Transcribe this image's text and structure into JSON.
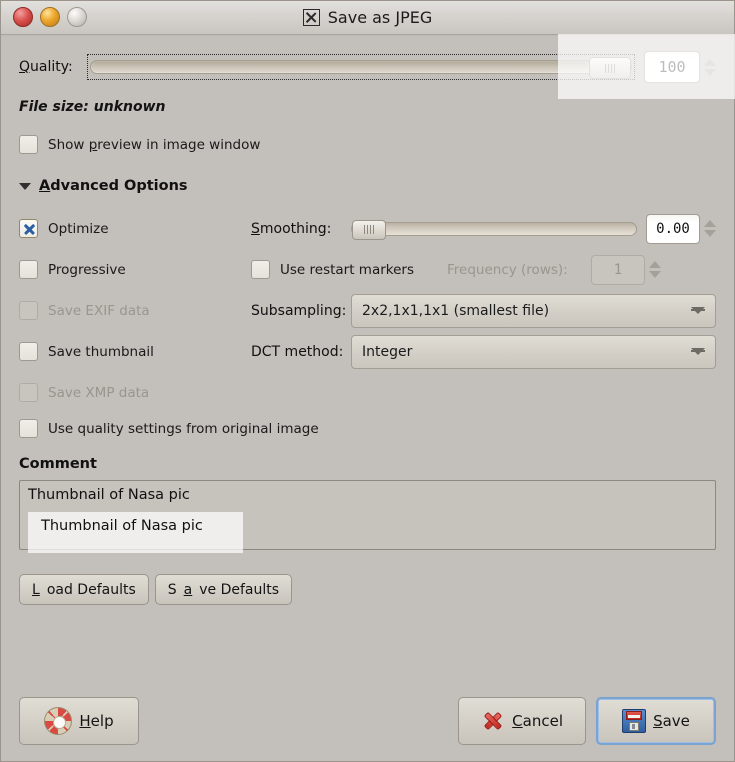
{
  "window": {
    "title": "Save as JPEG",
    "title_icon": "x-box-icon",
    "controls": {
      "close": "close-button",
      "minimize": "minimize-button",
      "maximize": "maximize-button"
    }
  },
  "quality": {
    "label": "Quality:",
    "label_mnemonic": "Q",
    "value": "100",
    "slider_percent": 100
  },
  "file_size": {
    "text": "File size: unknown"
  },
  "preview": {
    "label": "Show preview in image window",
    "mnemonic": "p",
    "checked": false
  },
  "advanced": {
    "label": "Advanced Options",
    "mnemonic": "A",
    "expanded": true,
    "checkboxes": [
      {
        "label": "Optimize",
        "checked": true,
        "enabled": true
      },
      {
        "label": "Progressive",
        "checked": false,
        "enabled": true
      },
      {
        "label": "Save EXIF data",
        "checked": false,
        "enabled": false
      },
      {
        "label": "Save thumbnail",
        "checked": false,
        "enabled": true
      },
      {
        "label": "Save XMP data",
        "checked": false,
        "enabled": false
      },
      {
        "label": "Use quality settings from original image",
        "checked": false,
        "enabled": true
      }
    ],
    "smoothing": {
      "label": "Smoothing:",
      "mnemonic": "S",
      "value": "0.00",
      "slider_percent": 0
    },
    "restart": {
      "label": "Use restart markers",
      "checked": false
    },
    "frequency": {
      "label": "Frequency (rows):",
      "value": "1",
      "enabled": false
    },
    "subsampling": {
      "label": "Subsampling:",
      "value": "2x2,1x1,1x1 (smallest file)"
    },
    "dct": {
      "label": "DCT method:",
      "value": "Integer"
    }
  },
  "comment": {
    "label": "Comment",
    "value": "Thumbnail of Nasa pic"
  },
  "defaults": {
    "load": "Load Defaults",
    "load_mnemonic": "L",
    "save": "Save Defaults",
    "save_mnemonic": "a"
  },
  "actions": {
    "help": "Help",
    "help_mnemonic": "H",
    "cancel": "Cancel",
    "cancel_mnemonic": "C",
    "save": "Save",
    "save_mnemonic": "S"
  },
  "colors": {
    "background": "#c3bfba",
    "titlebar": "#d6d3cf",
    "check_mark": "#2a5fa5",
    "focus_ring": "#7ba3d0",
    "close_button": "#d9534f",
    "minimize_button": "#eda52a"
  }
}
